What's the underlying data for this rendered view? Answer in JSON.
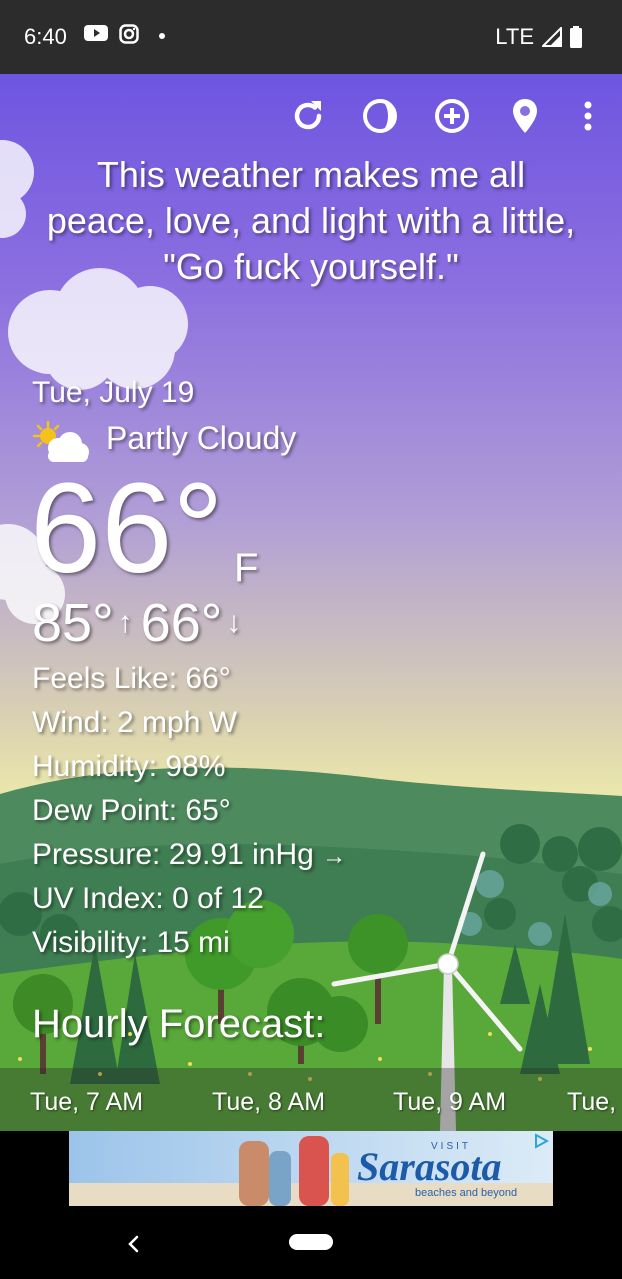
{
  "status_bar": {
    "time": "6:40",
    "network": "LTE"
  },
  "toolbar": {
    "icons": [
      "refresh-icon",
      "moon-phase-icon",
      "add-location-icon",
      "location-pin-icon",
      "more-vert-icon"
    ]
  },
  "quote": "This weather makes me all peace, love, and light with a little, \"Go fuck yourself.\"",
  "weather": {
    "date": "Tue, July 19",
    "condition": "Partly Cloudy",
    "temp": "66°",
    "unit": "F",
    "high": "85°",
    "low": "66°",
    "details": {
      "feels_like": "Feels Like:  66°",
      "wind": "Wind:  2 mph W",
      "humidity": "Humidity:  98%",
      "dew_point": "Dew Point:  65°",
      "pressure": "Pressure:  29.91 inHg",
      "uv_index": "UV Index:  0 of 12",
      "visibility": "Visibility:  15 mi"
    }
  },
  "hourly": {
    "title": "Hourly Forecast:",
    "hours": [
      "Tue, 7 AM",
      "Tue, 8 AM",
      "Tue, 9 AM",
      "Tue,"
    ]
  },
  "ad": {
    "visit": "VISIT",
    "brand": "Sarasota",
    "tagline": "beaches and beyond"
  }
}
